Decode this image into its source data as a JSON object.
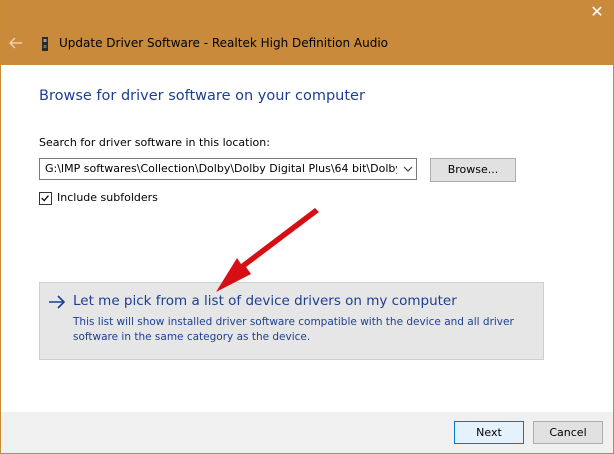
{
  "window": {
    "title": "Update Driver Software - Realtek High Definition Audio",
    "close_glyph": "✕",
    "titlebar_color": "#c98a3c"
  },
  "main": {
    "heading": "Browse for driver software on your computer",
    "search_label": "Search for driver software in this location:",
    "path_value": "G:\\IMP softwares\\Collection\\Dolby\\Dolby Digital Plus\\64 bit\\Dolby",
    "browse_label": "Browse...",
    "include_subfolders": {
      "label": "Include subfolders",
      "checked": true
    },
    "pick_option": {
      "title": "Let me pick from a list of device drivers on my computer",
      "description": "This list will show installed driver software compatible with the device and all driver software in the same category as the device."
    }
  },
  "footer": {
    "next_label": "Next",
    "cancel_label": "Cancel"
  },
  "icons": {
    "back": "back-arrow-icon",
    "device": "device-icon",
    "dropdown": "chevron-down-icon",
    "check": "checkmark-icon",
    "option_arrow": "right-arrow-icon",
    "cursor": "mouse-pointer-icon",
    "annotation": "red-arrow-annotation"
  },
  "colors": {
    "accent_blue": "#1c3f94",
    "annotation_red": "#e8141a",
    "default_button_border": "#0078d7"
  }
}
